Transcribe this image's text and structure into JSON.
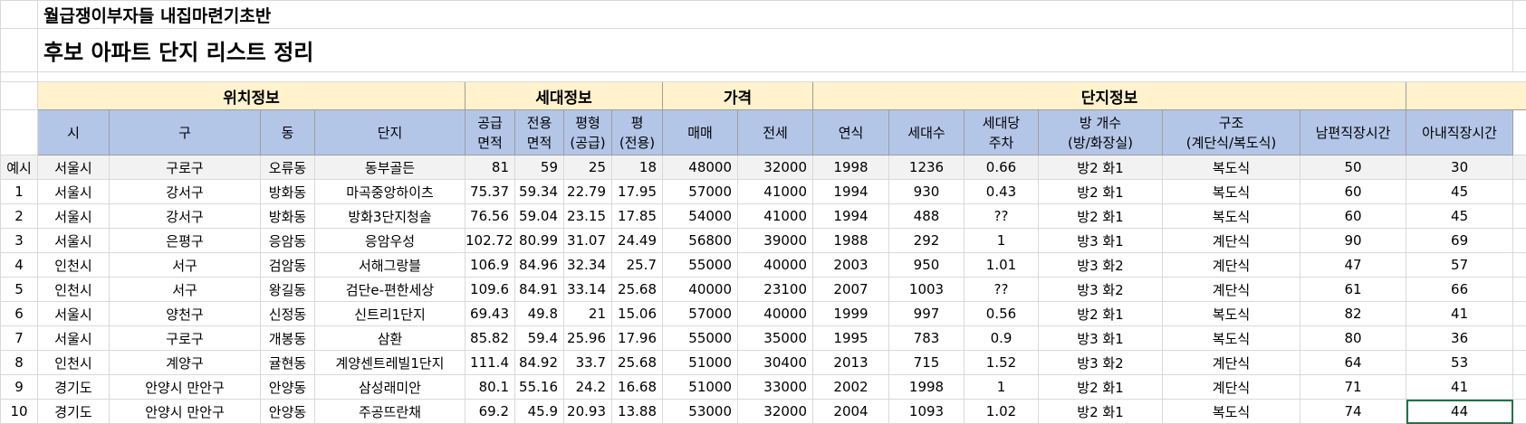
{
  "title1": "월급쟁이부자들 내집마련기초반",
  "title2": "후보 아파트 단지 리스트 정리",
  "groups": {
    "location": "위치정보",
    "household": "세대정보",
    "price": "가격",
    "complex": "단지정보"
  },
  "headers": {
    "si": "시",
    "gu": "구",
    "dong": "동",
    "danji": "단지",
    "supply_area": "공급\n면적",
    "exclusive_area": "전용\n면적",
    "pyeong_supply": "평형\n(공급)",
    "pyeong_excl": "평\n(전용)",
    "sale": "매매",
    "jeonse": "전세",
    "year": "연식",
    "households": "세대수",
    "parking": "세대당\n주차",
    "rooms": "방 개수\n(방/화장실)",
    "structure": "구조\n(계단식/복도식)",
    "husband_commute": "남편직장시간",
    "wife_commute": "아내직장시간"
  },
  "rows": [
    {
      "no": "예시",
      "si": "서울시",
      "gu": "구로구",
      "dong": "오류동",
      "danji": "동부골든",
      "supply": "81",
      "excl": "59",
      "py_s": "25",
      "py_e": "18",
      "sale": "48000",
      "jeonse": "32000",
      "year": "1998",
      "hh": "1236",
      "park": "0.66",
      "rooms": "방2 화1",
      "struct": "복도식",
      "hus": "50",
      "wife": "30"
    },
    {
      "no": "1",
      "si": "서울시",
      "gu": "강서구",
      "dong": "방화동",
      "danji": "마곡중앙하이츠",
      "supply": "75.37",
      "excl": "59.34",
      "py_s": "22.79",
      "py_e": "17.95",
      "sale": "57000",
      "jeonse": "41000",
      "year": "1994",
      "hh": "930",
      "park": "0.43",
      "rooms": "방2 화1",
      "struct": "복도식",
      "hus": "60",
      "wife": "45"
    },
    {
      "no": "2",
      "si": "서울시",
      "gu": "강서구",
      "dong": "방화동",
      "danji": "방화3단지청솔",
      "supply": "76.56",
      "excl": "59.04",
      "py_s": "23.15",
      "py_e": "17.85",
      "sale": "54000",
      "jeonse": "41000",
      "year": "1994",
      "hh": "488",
      "park": "??",
      "rooms": "방2 화1",
      "struct": "복도식",
      "hus": "60",
      "wife": "45"
    },
    {
      "no": "3",
      "si": "서울시",
      "gu": "은평구",
      "dong": "응암동",
      "danji": "응암우성",
      "supply": "102.72",
      "excl": "80.99",
      "py_s": "31.07",
      "py_e": "24.49",
      "sale": "56800",
      "jeonse": "39000",
      "year": "1988",
      "hh": "292",
      "park": "1",
      "rooms": "방3 화1",
      "struct": "계단식",
      "hus": "90",
      "wife": "69"
    },
    {
      "no": "4",
      "si": "인천시",
      "gu": "서구",
      "dong": "검암동",
      "danji": "서해그랑블",
      "supply": "106.9",
      "excl": "84.96",
      "py_s": "32.34",
      "py_e": "25.7",
      "sale": "55000",
      "jeonse": "40000",
      "year": "2003",
      "hh": "950",
      "park": "1.01",
      "rooms": "방3 화2",
      "struct": "계단식",
      "hus": "47",
      "wife": "57"
    },
    {
      "no": "5",
      "si": "인천시",
      "gu": "서구",
      "dong": "왕길동",
      "danji": "검단e-편한세상",
      "supply": "109.6",
      "excl": "84.91",
      "py_s": "33.14",
      "py_e": "25.68",
      "sale": "40000",
      "jeonse": "23100",
      "year": "2007",
      "hh": "1003",
      "park": "??",
      "rooms": "방3 화2",
      "struct": "계단식",
      "hus": "61",
      "wife": "66"
    },
    {
      "no": "6",
      "si": "서울시",
      "gu": "양천구",
      "dong": "신정동",
      "danji": "신트리1단지",
      "supply": "69.43",
      "excl": "49.8",
      "py_s": "21",
      "py_e": "15.06",
      "sale": "57000",
      "jeonse": "40000",
      "year": "1999",
      "hh": "997",
      "park": "0.56",
      "rooms": "방2 화1",
      "struct": "복도식",
      "hus": "82",
      "wife": "41"
    },
    {
      "no": "7",
      "si": "서울시",
      "gu": "구로구",
      "dong": "개봉동",
      "danji": "삼환",
      "supply": "85.82",
      "excl": "59.4",
      "py_s": "25.96",
      "py_e": "17.96",
      "sale": "55000",
      "jeonse": "35000",
      "year": "1995",
      "hh": "783",
      "park": "0.9",
      "rooms": "방3 화1",
      "struct": "복도식",
      "hus": "80",
      "wife": "36"
    },
    {
      "no": "8",
      "si": "인천시",
      "gu": "계양구",
      "dong": "귤현동",
      "danji": "계양센트레빌1단지",
      "supply": "111.4",
      "excl": "84.92",
      "py_s": "33.7",
      "py_e": "25.68",
      "sale": "51000",
      "jeonse": "30400",
      "year": "2013",
      "hh": "715",
      "park": "1.52",
      "rooms": "방3 화2",
      "struct": "계단식",
      "hus": "64",
      "wife": "53"
    },
    {
      "no": "9",
      "si": "경기도",
      "gu": "안양시 만안구",
      "dong": "안양동",
      "danji": "삼성래미안",
      "supply": "80.1",
      "excl": "55.16",
      "py_s": "24.2",
      "py_e": "16.68",
      "sale": "51000",
      "jeonse": "33000",
      "year": "2002",
      "hh": "1998",
      "park": "1",
      "rooms": "방2 화1",
      "struct": "계단식",
      "hus": "71",
      "wife": "41"
    },
    {
      "no": "10",
      "si": "경기도",
      "gu": "안양시 만안구",
      "dong": "안양동",
      "danji": "주공뜨란채",
      "supply": "69.2",
      "excl": "45.9",
      "py_s": "20.93",
      "py_e": "13.88",
      "sale": "53000",
      "jeonse": "32000",
      "year": "2004",
      "hh": "1093",
      "park": "1.02",
      "rooms": "방2 화1",
      "struct": "복도식",
      "hus": "74",
      "wife": "44"
    }
  ]
}
